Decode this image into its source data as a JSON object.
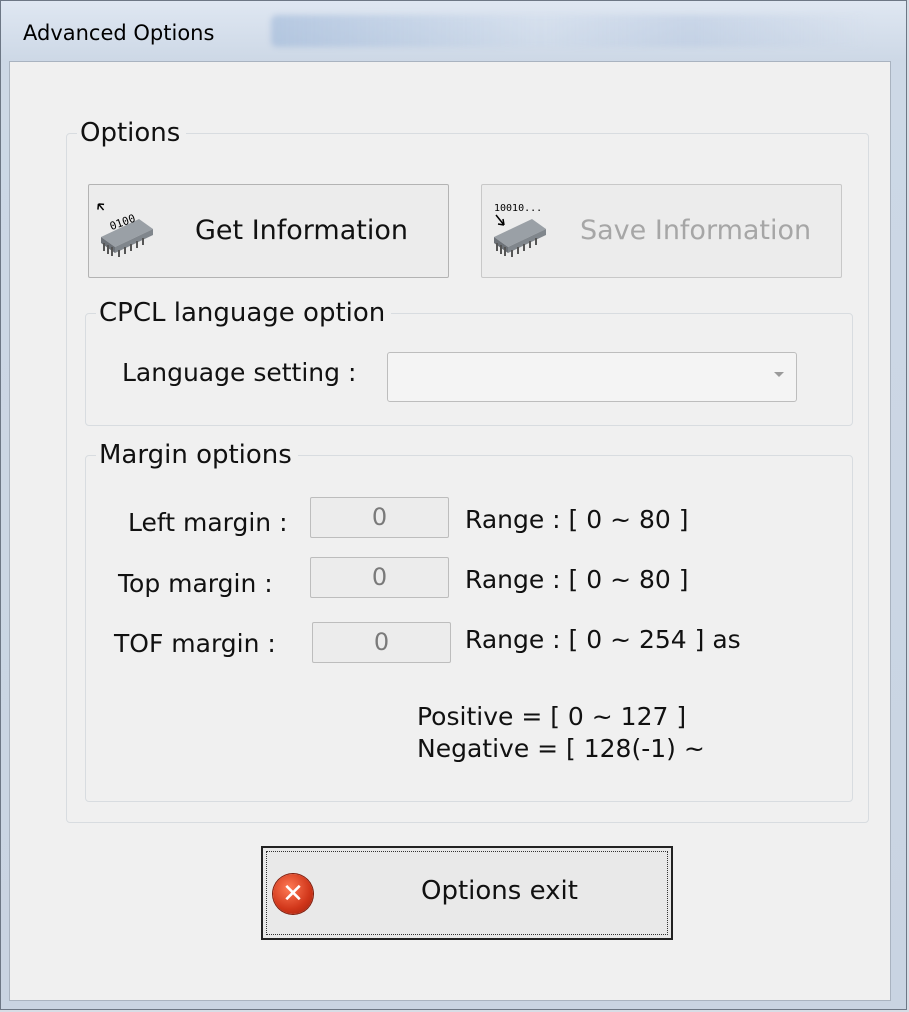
{
  "window": {
    "title": "Advanced Options"
  },
  "options_group": {
    "legend": "Options",
    "get_info_button": "Get Information",
    "save_info_button": "Save Information",
    "get_icon_text": "0100",
    "save_icon_text": "10010..."
  },
  "cpcl_group": {
    "legend": "CPCL language option",
    "language_label": "Language setting :",
    "language_value": ""
  },
  "margin_group": {
    "legend": "Margin options",
    "left_label": "Left margin :",
    "left_value": "0",
    "left_range": "Range : [ 0 ~ 80 ]",
    "top_label": "Top margin :",
    "top_value": "0",
    "top_range": "Range : [ 0 ~ 80 ]",
    "tof_label": "TOF margin :",
    "tof_value": "0",
    "tof_range": "Range : [ 0 ~ 254 ] as",
    "positive_note": "Positive = [ 0 ~ 127 ]",
    "negative_note": "Negative = [ 128(-1) ~"
  },
  "exit_button": {
    "label": "Options exit"
  },
  "colors": {
    "disabled_text": "#a6a6a6",
    "exit_icon_red": "#d0361a"
  }
}
